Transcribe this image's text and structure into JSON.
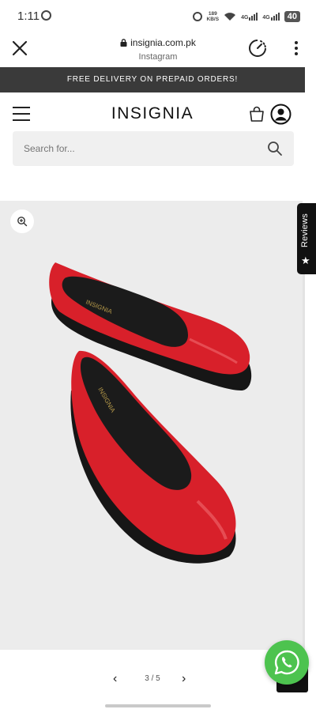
{
  "status_bar": {
    "time": "1:11",
    "net_speed_value": "189",
    "net_speed_unit": "KB/S",
    "net1": "4G",
    "net2": "4G",
    "battery": "40"
  },
  "browser": {
    "url": "insignia.com.pk",
    "source": "Instagram"
  },
  "announcement": "FREE DELIVERY ON PREPAID ORDERS!",
  "header": {
    "logo": "INSIGNIA"
  },
  "search": {
    "placeholder": "Search for..."
  },
  "product": {
    "insole_brand": "INSIGNIA",
    "shoe_color": "#d8202a"
  },
  "reviews_tab": {
    "label": "Reviews"
  },
  "pagination": {
    "prev": "‹",
    "count": "3 / 5",
    "next": "›"
  },
  "colors": {
    "announcement_bg": "#3a3a3a",
    "whatsapp": "#4dc34f",
    "media_bg": "#ececec"
  }
}
